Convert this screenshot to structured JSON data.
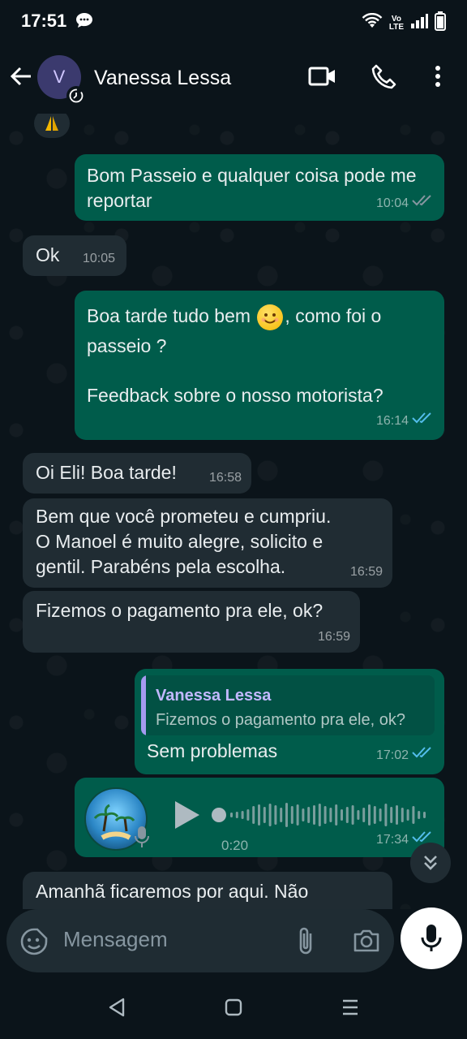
{
  "status": {
    "time": "17:51",
    "volte_top": "Vo",
    "volte_bottom": "LTE"
  },
  "header": {
    "avatar_letter": "V",
    "contact_name": "Vanessa Lessa"
  },
  "messages": [
    {
      "dir": "out",
      "text": "Bom Passeio e qualquer coisa pode me reportar",
      "time": "10:04",
      "ticks": "sent"
    },
    {
      "dir": "in",
      "text": "Ok",
      "time": "10:05"
    },
    {
      "dir": "out",
      "text_before_emoji": "Boa tarde tudo bem ",
      "text_after_emoji": ", como foi o passeio ?",
      "text2": "Feedback sobre o nosso motorista?",
      "time": "16:14",
      "ticks": "read"
    },
    {
      "dir": "in",
      "text": "Oi Eli! Boa tarde!",
      "time": "16:58"
    },
    {
      "dir": "in",
      "text": "Bem que você prometeu e cumpriu.\nO Manoel é muito alegre, solicito e gentil. Parabéns pela escolha.",
      "time": "16:59"
    },
    {
      "dir": "in",
      "text": "Fizemos o pagamento pra ele, ok?",
      "time": "16:59"
    },
    {
      "dir": "out",
      "quote_name": "Vanessa Lessa",
      "quote_text": "Fizemos o pagamento pra ele, ok?",
      "text": "Sem problemas",
      "time": "17:02",
      "ticks": "read"
    },
    {
      "dir": "out",
      "type": "voice",
      "duration": "0:20",
      "time": "17:34",
      "ticks": "read"
    },
    {
      "dir": "in",
      "text": "Amanhã ficaremos por aqui. Não"
    }
  ],
  "composer": {
    "placeholder": "Mensagem"
  },
  "colors": {
    "outgoing": "#005c4b",
    "incoming": "#202c33",
    "read_ticks": "#53bdeb"
  }
}
